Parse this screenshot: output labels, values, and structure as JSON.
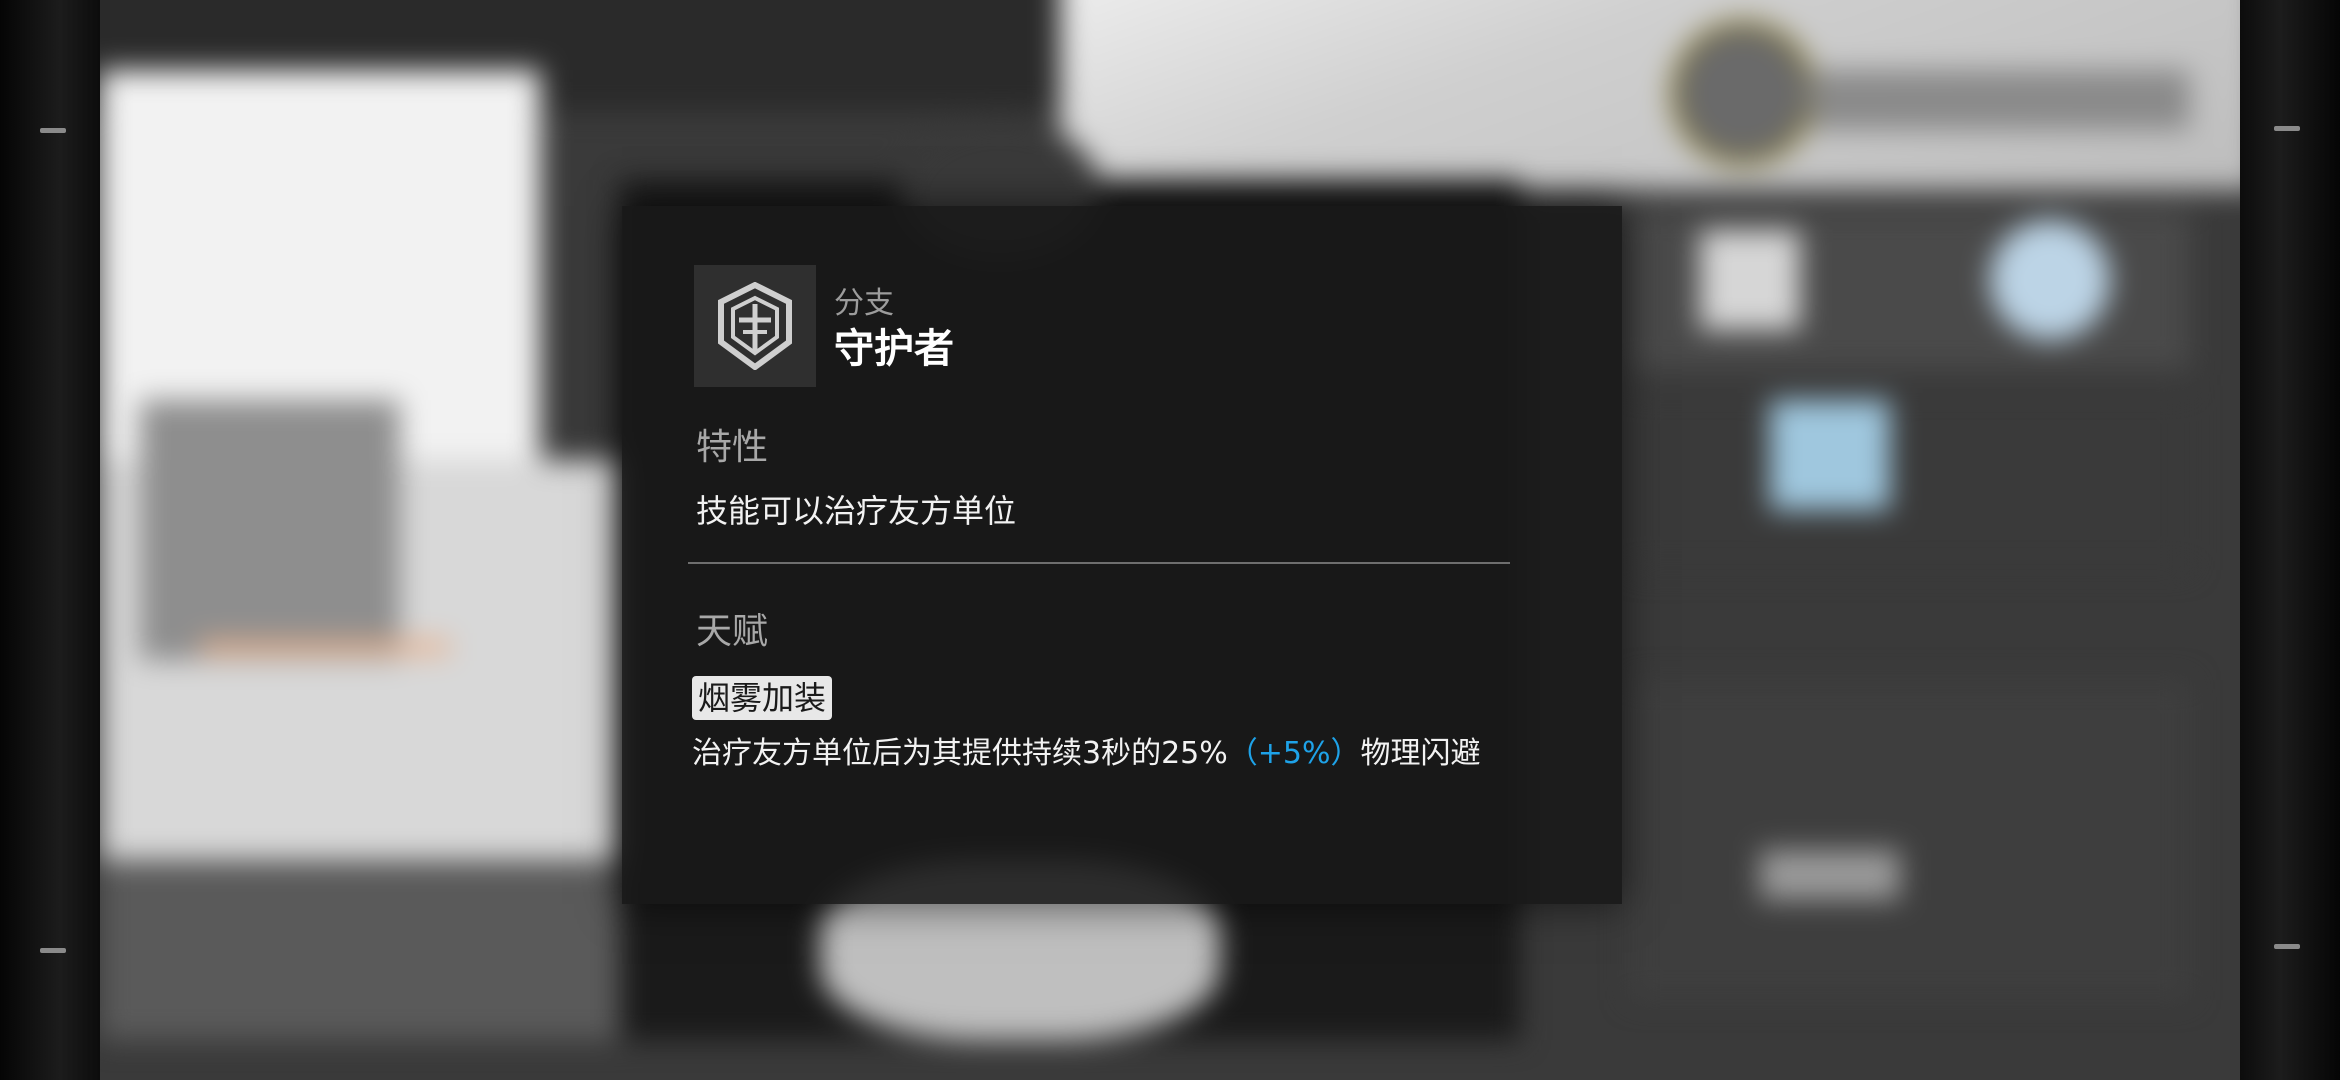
{
  "modal": {
    "branch": {
      "label": "分支",
      "name": "守护者",
      "icon": "guardian-shield-icon"
    },
    "trait": {
      "title": "特性",
      "text": "技能可以治疗友方单位"
    },
    "talent": {
      "title": "天赋",
      "name": "烟雾加装",
      "desc_before": "治疗友方单位后为其提供持续3秒的25%",
      "desc_bonus": "（+5%）",
      "desc_after": "物理闪避"
    }
  },
  "colors": {
    "modal_bg": "#181818",
    "bonus_text": "#1ea2e8",
    "tag_bg": "#e8e8e8"
  }
}
